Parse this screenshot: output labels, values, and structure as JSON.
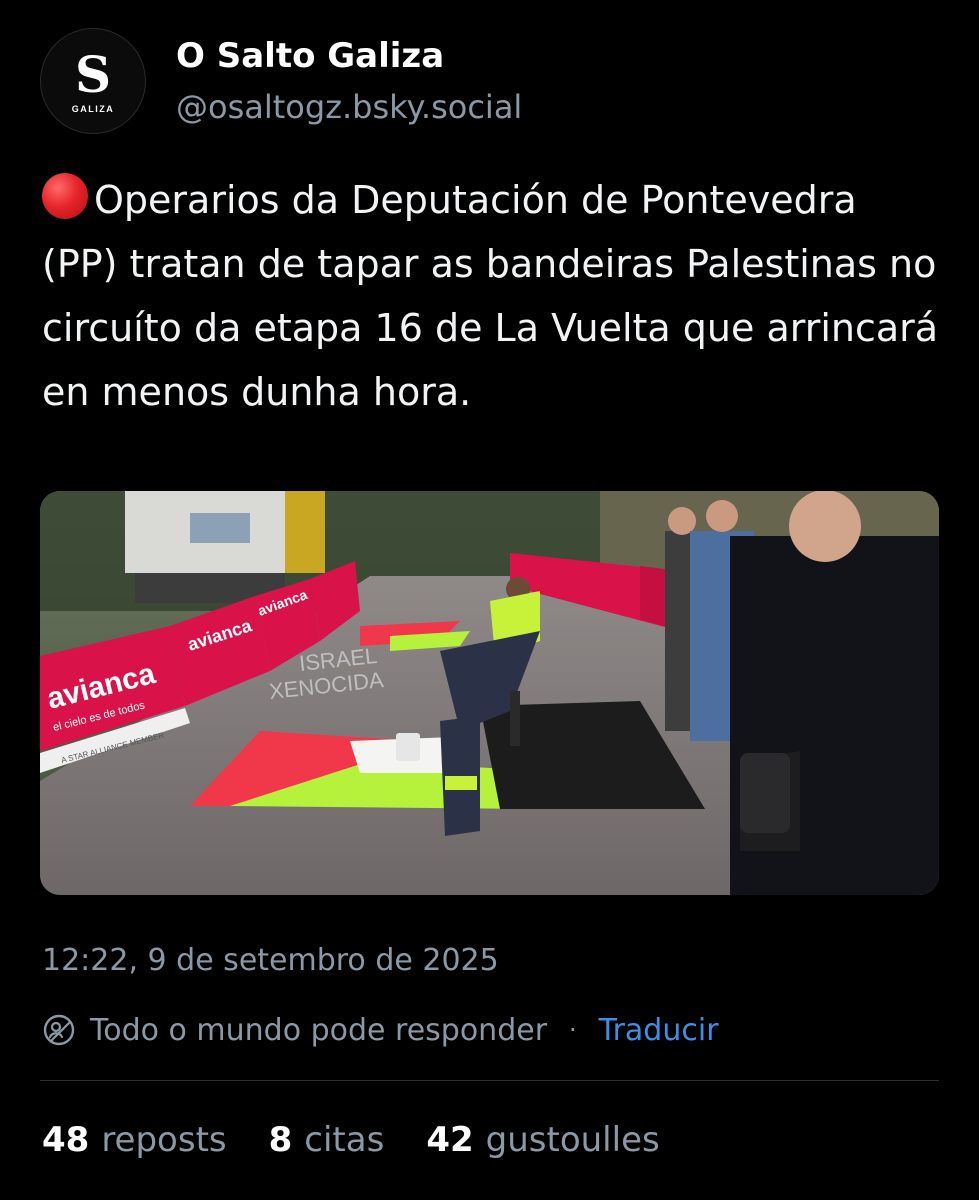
{
  "author": {
    "display_name": "O Salto Galiza",
    "handle": "@osaltogz.bsky.social",
    "avatar": {
      "letter": "S",
      "sub_text": "GALIZA"
    }
  },
  "post": {
    "emoji": "red-circle",
    "text": "Operarios da Deputación de Pontevedra (PP) tratan de tapar as bandeiras Palestinas no circuíto da etapa 16 de La Vuelta que arrincará en menos dunha hora."
  },
  "photo": {
    "banner_brand": "avianca",
    "banner_tagline": "el cielo es de todos",
    "banner_footer": "A STAR ALLIANCE MEMBER",
    "road_text_1": "ISRAEL",
    "road_text_2": "XENOCIDA"
  },
  "meta": {
    "timestamp": "12:22, 9 de setembro de 2025",
    "reply_setting": "Todo o mundo pode responder",
    "separator": "·",
    "translate_label": "Traducir"
  },
  "stats": {
    "reposts": {
      "count": "48",
      "label": "reposts"
    },
    "quotes": {
      "count": "8",
      "label": "citas"
    },
    "likes": {
      "count": "42",
      "label": "gustoulles"
    }
  },
  "colors": {
    "background": "#000000",
    "text_primary": "#f1f3f5",
    "text_secondary": "#8b98a5",
    "link": "#3d8fe6",
    "avianca_red": "#d9134a",
    "paint_red": "#f0384a",
    "paint_green": "#b6f23c"
  }
}
